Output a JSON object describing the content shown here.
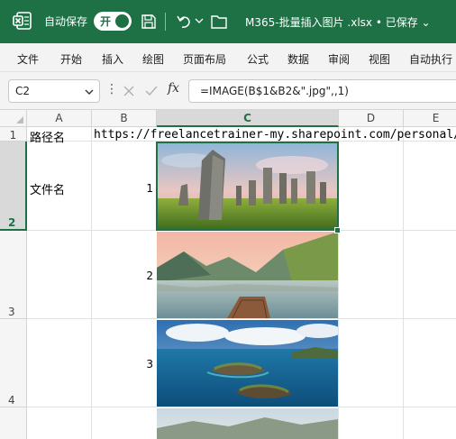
{
  "titlebar": {
    "autosave_label": "自动保存",
    "toggle_label": "开",
    "doc_title": "M365-批量插入图片 .xlsx • 已保存 ⌄",
    "icons": [
      "excel-icon",
      "save-icon",
      "undo-icon",
      "folder-icon"
    ],
    "bg_color": "#1e7145"
  },
  "ribbon": {
    "tabs": [
      "文件",
      "开始",
      "插入",
      "绘图",
      "页面布局",
      "公式",
      "数据",
      "审阅",
      "视图",
      "自动执行"
    ]
  },
  "formula_bar": {
    "name_box": "C2",
    "fx": "fx",
    "formula": "=IMAGE(B$1&B2&\".jpg\",,1)"
  },
  "sheet": {
    "columns": [
      "A",
      "B",
      "C",
      "D",
      "E"
    ],
    "rows": [
      "1",
      "2",
      "3",
      "4"
    ],
    "selected_cell": "C2",
    "cells": {
      "A1": "路径名",
      "B1": "https://freelancetrainer-my.sharepoint.com/personal/",
      "A2": "文件名",
      "B2": "1",
      "B3": "2",
      "B4": "3"
    },
    "images": [
      {
        "cell": "C2",
        "subject": "standing-stones-landscape"
      },
      {
        "cell": "C3",
        "subject": "mountain-lake-pier"
      },
      {
        "cell": "C4",
        "subject": "islands-ocean-aerial"
      },
      {
        "cell": "C5",
        "subject": "coastal-landscape"
      }
    ]
  }
}
